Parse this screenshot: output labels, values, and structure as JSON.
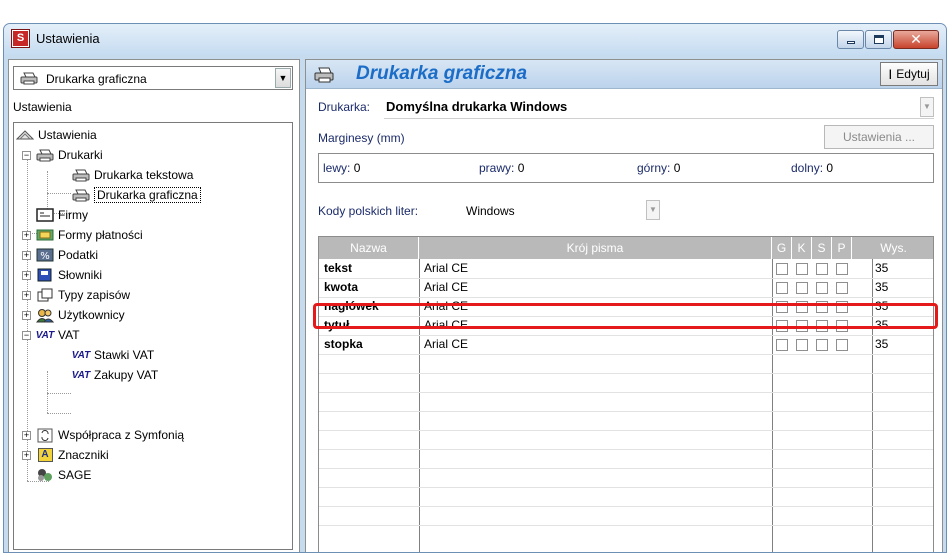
{
  "window": {
    "title": "Ustawienia",
    "app_icon_letter": "S"
  },
  "left": {
    "combo_value": "Drukarka graficzna",
    "section_label": "Ustawienia",
    "tree": {
      "root": "Ustawienia",
      "drukarki": "Drukarki",
      "drukarka_tekstowa": "Drukarka tekstowa",
      "drukarka_graficzna": "Drukarka graficzna",
      "firmy": "Firmy",
      "formy_platnosci": "Formy płatności",
      "podatki": "Podatki",
      "slowniki": "Słowniki",
      "typy_zapisow": "Typy zapisów",
      "uzytkownicy": "Użytkownicy",
      "vat": "VAT",
      "stawki_vat": "Stawki VAT",
      "zakupy_vat": "Zakupy VAT",
      "wspolpraca": "Współpraca z Symfonią",
      "znaczniki": "Znaczniki",
      "sage": "SAGE"
    },
    "vat_badge": "VAT",
    "znaczniki_badge": "A"
  },
  "right": {
    "header_title": "Drukarka graficzna",
    "edit_label": "Edytuj",
    "printer_label": "Drukarka:",
    "printer_value": "Domyślna drukarka Windows",
    "margins_label": "Marginesy (mm)",
    "settings_button": "Ustawienia ...",
    "margins": {
      "left_label": "lewy:",
      "left_value": "0",
      "right_label": "prawy:",
      "right_value": "0",
      "top_label": "górny:",
      "top_value": "0",
      "bottom_label": "dolny:",
      "bottom_value": "0"
    },
    "codes_label": "Kody polskich liter:",
    "codes_value": "Windows",
    "grid": {
      "headers": {
        "name": "Nazwa",
        "font": "Krój pisma",
        "g": "G",
        "k": "K",
        "s": "S",
        "p": "P",
        "wys": "Wys."
      },
      "rows": [
        {
          "name": "tekst",
          "font": "Arial CE",
          "wys": "35"
        },
        {
          "name": "kwota",
          "font": "Arial CE",
          "wys": "35"
        },
        {
          "name": "nagłówek",
          "font": "Arial CE",
          "wys": "35"
        },
        {
          "name": "tytuł",
          "font": "Arial CE",
          "wys": "35"
        },
        {
          "name": "stopka",
          "font": "Arial CE",
          "wys": "35"
        }
      ]
    }
  },
  "colors": {
    "accent_title": "#1b6dc7",
    "highlight": "#e41a1a",
    "grid_header": "#b9b9b9"
  }
}
